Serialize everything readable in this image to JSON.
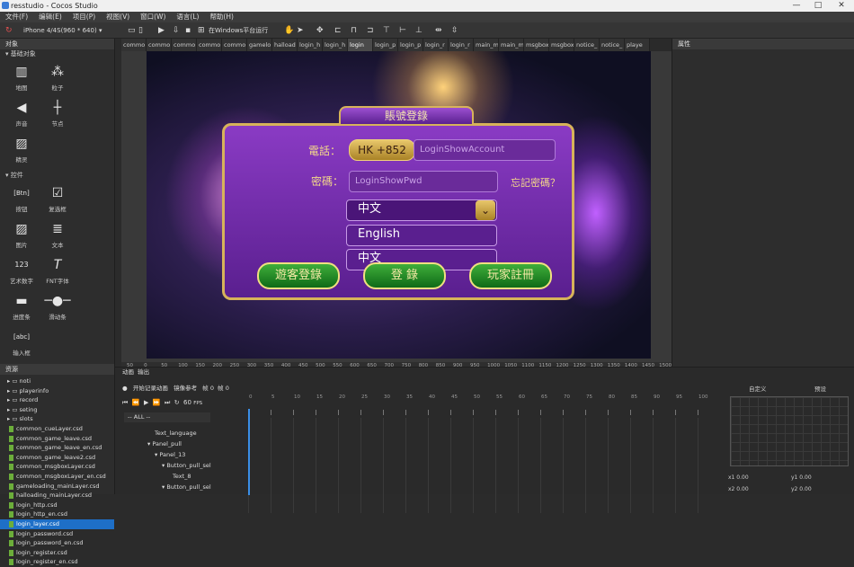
{
  "window": {
    "title": "resstudio - Cocos Studio",
    "controls": [
      "—",
      "□",
      "✕"
    ]
  },
  "menu": [
    "文件(F)",
    "编辑(E)",
    "项目(P)",
    "视图(V)",
    "窗口(W)",
    "语言(L)",
    "帮助(H)"
  ],
  "toolbar": {
    "device": "iPhone 4/4S(960 * 640)",
    "run_label": "在Windows平台运行"
  },
  "left_panel": {
    "title": "对象",
    "basic_section": "基础对象",
    "basic_items": [
      "地图",
      "粒子",
      "声音",
      "节点",
      "精灵"
    ],
    "controls_section": "控件",
    "control_items": [
      "按钮",
      "复选框",
      "图片",
      "文本",
      "艺术数字",
      "FNT字体",
      "进度条",
      "滑动条",
      "输入框"
    ],
    "resources_title": "资源",
    "folders": [
      "noti",
      "playerinfo",
      "record",
      "seting",
      "slots"
    ],
    "files": [
      "common_cueLayer.csd",
      "common_game_leave.csd",
      "common_game_leave_en.csd",
      "common_game_leave2.csd",
      "common_msgboxLayer.csd",
      "common_msgboxLayer_en.csd",
      "gameloading_mainLayer.csd",
      "halloading_mainLayer.csd",
      "login_http.csd",
      "login_http_en.csd",
      "login_layer.csd",
      "login_password.csd",
      "login_password_en.csd",
      "login_register.csd",
      "login_register_en.csd"
    ],
    "selected_file": "login_layer.csd"
  },
  "tabs": [
    "commo",
    "commo",
    "commo",
    "commo",
    "commo",
    "gamelo",
    "halload",
    "login_h",
    "login_h",
    "login",
    "login_p",
    "login_p",
    "login_r",
    "login_r",
    "main_m",
    "main_m",
    "msgbox",
    "msgbox",
    "notice_",
    "notice_",
    "playe"
  ],
  "active_tab": "login",
  "scene": {
    "title": "賬號登錄",
    "phone_label": "電話：",
    "code": "HK +852",
    "account_placeholder": "LoginShowAccount",
    "pwd_label": "密碼：",
    "pwd_placeholder": "LoginShowPwd",
    "forgot": "忘記密碼？",
    "lang_selected": "中文",
    "lang_options": [
      "English",
      "中文"
    ],
    "btn_guest": "遊客登錄",
    "btn_login": "登 錄",
    "btn_register": "玩家註冊"
  },
  "ruler": [
    "50",
    "0",
    "50",
    "100",
    "150",
    "200",
    "250",
    "300",
    "350",
    "400",
    "450",
    "500",
    "550",
    "600",
    "650",
    "700",
    "750",
    "800",
    "850",
    "900",
    "950",
    "1000",
    "1050",
    "1100",
    "1150",
    "1200",
    "1250",
    "1300",
    "1350",
    "1400",
    "1450",
    "1500"
  ],
  "right_panel": {
    "title": "属性"
  },
  "bottom": {
    "tabs": [
      "动画",
      "输出"
    ],
    "record_label": "开始记录动画",
    "ref_label": "镜像参考",
    "frame_label": "帧",
    "frame_value": "0",
    "time_label": "帧",
    "time_value": "0",
    "fps": "60",
    "fps_unit": "FPS",
    "filter": "-- ALL --",
    "custom_label": "自定义",
    "preset_label": "预设",
    "nodes": [
      "Text_language",
      "Panel_pull",
      "Panel_13",
      "Button_pull_sel",
      "Text_8",
      "Button_pull_sel"
    ],
    "timeline_marks": [
      "0",
      "5",
      "10",
      "15",
      "20",
      "25",
      "30",
      "35",
      "40",
      "45",
      "50",
      "55",
      "60",
      "65",
      "70",
      "75",
      "80",
      "85",
      "90",
      "95",
      "100"
    ],
    "coords": [
      {
        "label": "x1",
        "value": "0.00"
      },
      {
        "label": "y1",
        "value": "0.00"
      },
      {
        "label": "x2",
        "value": "0.00"
      },
      {
        "label": "y2",
        "value": "0.00"
      }
    ]
  }
}
